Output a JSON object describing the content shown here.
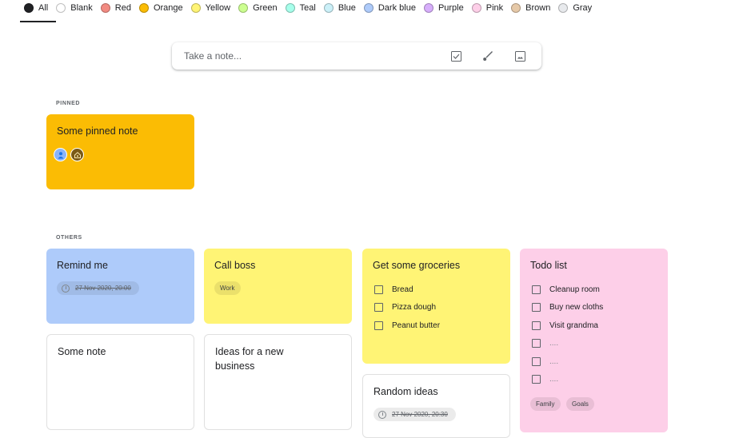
{
  "color_filters": [
    {
      "label": "All",
      "color": "#202124",
      "active": true
    },
    {
      "label": "Blank",
      "color": "#ffffff"
    },
    {
      "label": "Red",
      "color": "#f28b82"
    },
    {
      "label": "Orange",
      "color": "#fbbc04"
    },
    {
      "label": "Yellow",
      "color": "#fff475"
    },
    {
      "label": "Green",
      "color": "#ccff90"
    },
    {
      "label": "Teal",
      "color": "#a7ffeb"
    },
    {
      "label": "Blue",
      "color": "#cbf0f8"
    },
    {
      "label": "Dark blue",
      "color": "#aecbfa"
    },
    {
      "label": "Purple",
      "color": "#d7aefb"
    },
    {
      "label": "Pink",
      "color": "#fdcfe8"
    },
    {
      "label": "Brown",
      "color": "#e6c9a8"
    },
    {
      "label": "Gray",
      "color": "#e8eaed"
    }
  ],
  "composer": {
    "placeholder": "Take a note...",
    "icons": [
      "checkbox-icon",
      "brush-icon",
      "image-icon"
    ]
  },
  "sections": {
    "pinned": "PINNED",
    "others": "OTHERS"
  },
  "pinned_notes": [
    {
      "title": "Some pinned note",
      "color": "#fbbc04",
      "collaborators": [
        "user-avatar",
        "home-avatar"
      ]
    }
  ],
  "notes": [
    {
      "title": "Remind me",
      "color": "#aecbfa",
      "reminder": "27 Nov 2020, 20:00"
    },
    {
      "title": "Call boss",
      "color": "#fff475",
      "labels": [
        "Work"
      ]
    },
    {
      "title": "Get some groceries",
      "color": "#fff475",
      "items": [
        "Bread",
        "Pizza dough",
        "Peanut butter"
      ]
    },
    {
      "title": "Todo list",
      "color": "#fdcfe8",
      "items": [
        "Cleanup room",
        "Buy new cloths",
        "Visit grandma",
        "....",
        "....",
        "...."
      ],
      "labels": [
        "Family",
        "Goals"
      ]
    },
    {
      "title": "Some note",
      "color": "#ffffff"
    },
    {
      "title": "Ideas for a new business",
      "color": "#ffffff"
    },
    {
      "title": "Random ideas",
      "color": "#ffffff",
      "reminder": "27 Nov 2020, 20:30"
    }
  ]
}
